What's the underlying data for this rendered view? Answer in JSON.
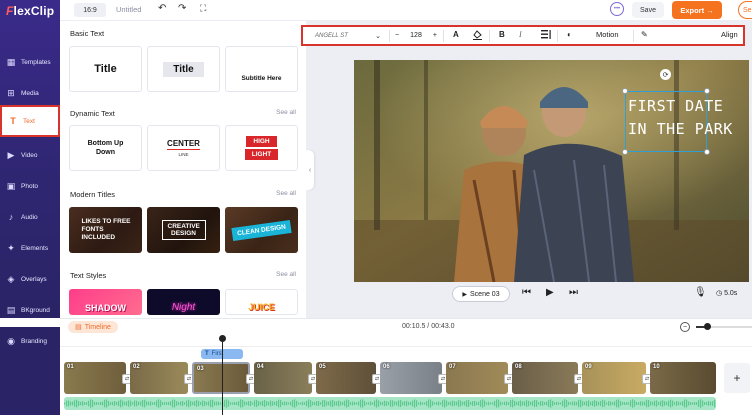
{
  "app": {
    "logo": "FlexClip",
    "ratio": "16:9",
    "title": "Untitled",
    "save_label": "Save",
    "export_label": "Export →",
    "share_label": "Se"
  },
  "sidebar": {
    "items": [
      {
        "label": "Templates",
        "icon": "templates-icon"
      },
      {
        "label": "Media",
        "icon": "media-icon"
      },
      {
        "label": "Text",
        "icon": "text-icon"
      },
      {
        "label": "Video",
        "icon": "video-icon"
      },
      {
        "label": "Photo",
        "icon": "photo-icon"
      },
      {
        "label": "Audio",
        "icon": "audio-icon"
      },
      {
        "label": "Elements",
        "icon": "elements-icon"
      },
      {
        "label": "Overlays",
        "icon": "overlays-icon"
      },
      {
        "label": "BKground",
        "icon": "background-icon"
      },
      {
        "label": "Branding",
        "icon": "branding-icon"
      }
    ],
    "active": "Text"
  },
  "panel": {
    "basic": {
      "title": "Basic Text",
      "cards": [
        "Title",
        "Title",
        "Subtitle Here"
      ]
    },
    "dynamic": {
      "title": "Dynamic Text",
      "see_all": "See all",
      "cards": {
        "bottom": "Bottom Up Down",
        "center_big": "CENTER",
        "center_small": "LINE",
        "high": "HIGH",
        "light": "LIGHT"
      }
    },
    "modern": {
      "title": "Modern Titles",
      "see_all": "See all",
      "likes": "LIKES TO FREE FONTS INCLUDED",
      "creative": "CREATIVE DESIGN",
      "clean": "CLEAN DESIGN"
    },
    "styles": {
      "title": "Text Styles",
      "see_all": "See all",
      "shadow": "SHADOW",
      "night": "Night",
      "juice": "JUICE"
    }
  },
  "toolbar": {
    "font": "ANGELL ST",
    "size": "128",
    "minus": "−",
    "plus": "+",
    "bold": "B",
    "italic": "I",
    "motion": "Motion",
    "align": "Align"
  },
  "canvas": {
    "title_line1": "FIRST DATE",
    "title_line2": "IN THE PARK"
  },
  "player": {
    "scene": "Scene 03",
    "duration": "5.0s"
  },
  "timeline": {
    "label": "Timeline",
    "time": "00:10.5 / 00:43.0",
    "text_chip": "First",
    "zoom_level": 0.2,
    "clips": [
      "01",
      "02",
      "03",
      "04",
      "05",
      "06",
      "07",
      "08",
      "09",
      "10"
    ]
  },
  "colors": {
    "accent": "#f5721f",
    "sidebar": "#2e2670",
    "highlight": "#d9342b"
  }
}
